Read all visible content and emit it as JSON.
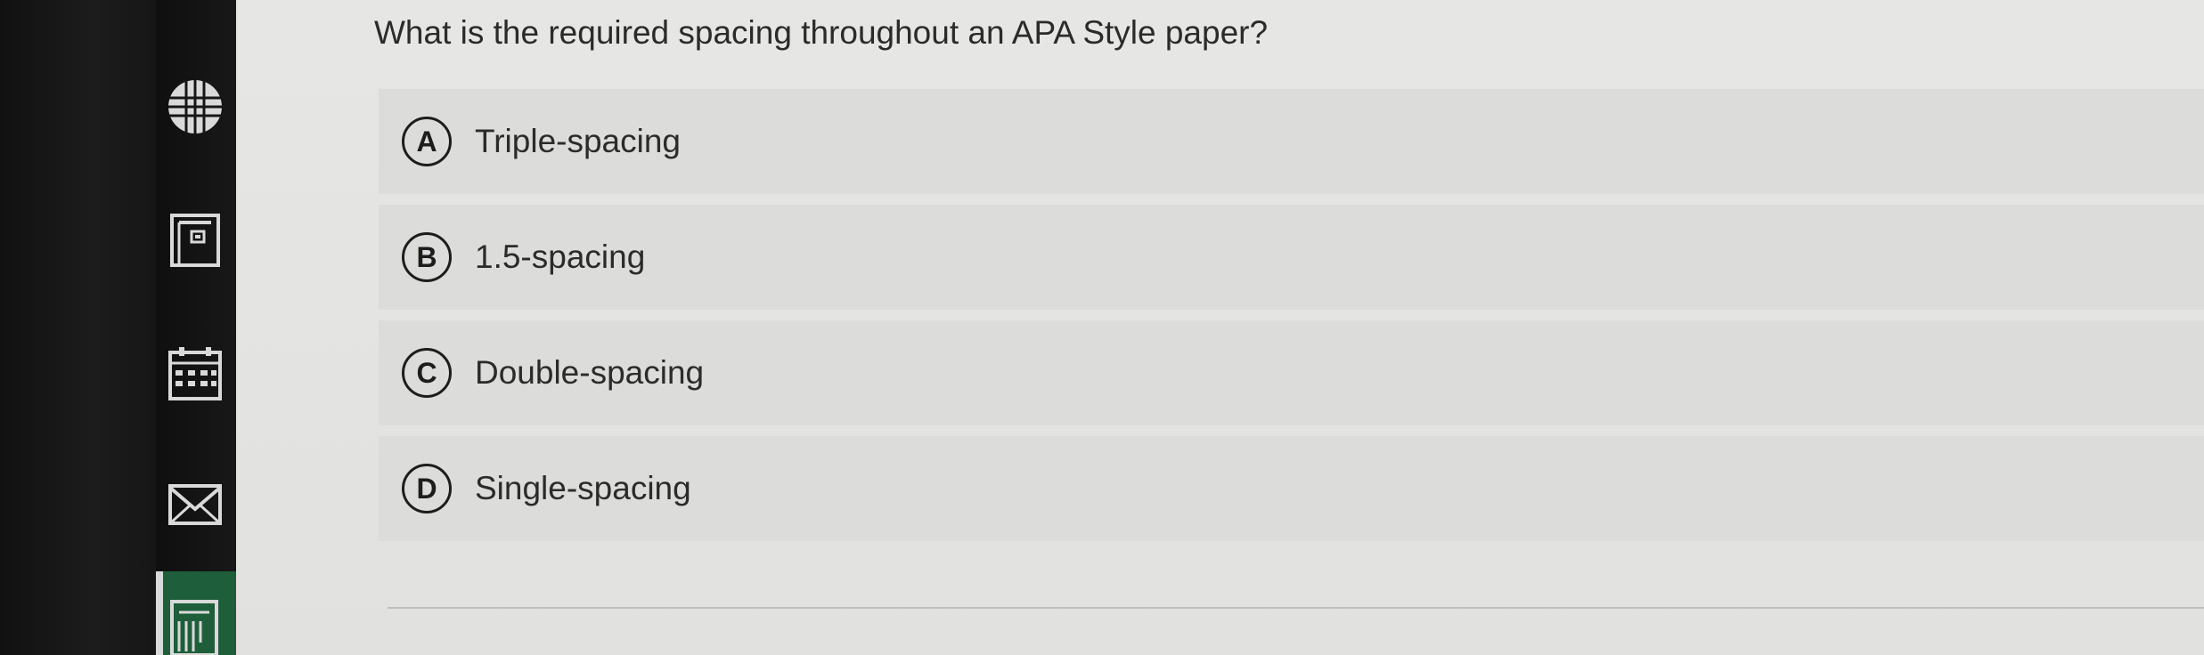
{
  "sidebar": {
    "icons": [
      "globe-icon",
      "book-icon",
      "calendar-icon",
      "mail-icon",
      "document-icon"
    ]
  },
  "question": {
    "text": "What is the required spacing throughout an APA Style paper?"
  },
  "options": [
    {
      "letter": "A",
      "label": "Triple-spacing"
    },
    {
      "letter": "B",
      "label": "1.5-spacing"
    },
    {
      "letter": "C",
      "label": "Double-spacing"
    },
    {
      "letter": "D",
      "label": "Single-spacing"
    }
  ],
  "colors": {
    "sidebar_bg": "#141414",
    "active_accent": "#1e5e3a",
    "content_bg": "#e3e3e1",
    "option_bg": "#dcdcda",
    "text": "#2b2b2b"
  }
}
